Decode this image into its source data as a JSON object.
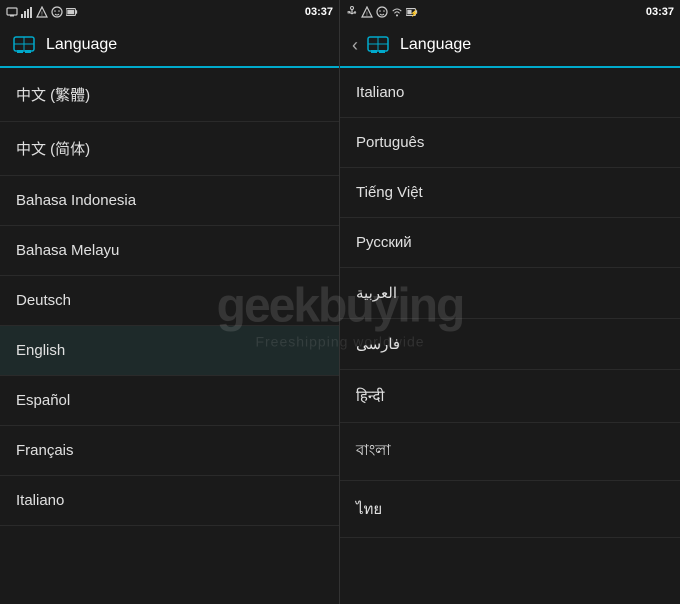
{
  "statusBar": {
    "left": {
      "time": "03:37",
      "icons": [
        "device",
        "warning",
        "triangle",
        "face",
        "battery"
      ]
    },
    "right": {
      "time": "03:37",
      "icons": [
        "signal",
        "wifi",
        "usb",
        "warning",
        "face",
        "battery-charging"
      ]
    }
  },
  "leftPanel": {
    "title": "Language",
    "languages": [
      {
        "name": "中文 (繁體)",
        "id": "zh-tw"
      },
      {
        "name": "中文 (简体)",
        "id": "zh-cn"
      },
      {
        "name": "Bahasa Indonesia",
        "id": "id"
      },
      {
        "name": "Bahasa Melayu",
        "id": "ms"
      },
      {
        "name": "Deutsch",
        "id": "de"
      },
      {
        "name": "English",
        "id": "en",
        "selected": true
      },
      {
        "name": "Español",
        "id": "es"
      },
      {
        "name": "Français",
        "id": "fr"
      },
      {
        "name": "Italiano",
        "id": "it"
      }
    ]
  },
  "rightPanel": {
    "title": "Language",
    "languages": [
      {
        "name": "Italiano",
        "id": "it"
      },
      {
        "name": "Português",
        "id": "pt"
      },
      {
        "name": "Tiếng Việt",
        "id": "vi"
      },
      {
        "name": "Русский",
        "id": "ru"
      },
      {
        "name": "العربية",
        "id": "ar"
      },
      {
        "name": "فارسی",
        "id": "fa"
      },
      {
        "name": "हिन्दी",
        "id": "hi"
      },
      {
        "name": "বাংলা",
        "id": "bn"
      },
      {
        "name": "ไทย",
        "id": "th"
      }
    ]
  },
  "watermark": {
    "text": "geekbuying",
    "subtext": "Freeshipping worldwide"
  }
}
